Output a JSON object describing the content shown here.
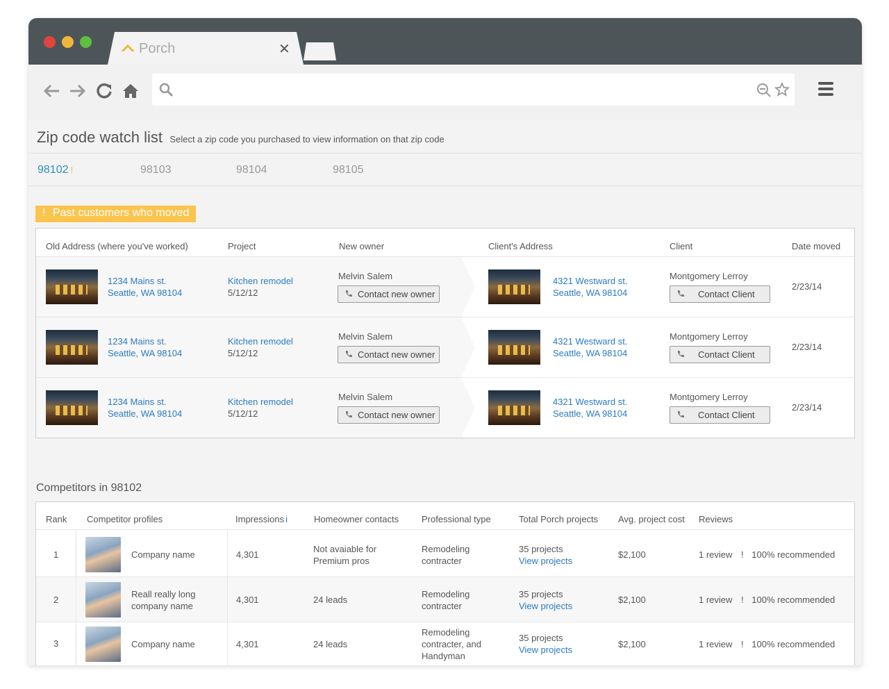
{
  "browser": {
    "tab_title": "Porch",
    "tab_close": "✕"
  },
  "page": {
    "title": "Zip code watch list",
    "subtitle": "Select a zip code you purchased to view information on that zip code",
    "zips": [
      {
        "label": "98102",
        "active": true,
        "marker": "!"
      },
      {
        "label": "98103"
      },
      {
        "label": "98104"
      },
      {
        "label": "98105"
      }
    ]
  },
  "past_customers": {
    "badge": "Past customers who moved",
    "badge_icon": "!",
    "headers": [
      "Old Address (where you've worked)",
      "Project",
      "New owner",
      "Client's Address",
      "Client",
      "Date moved"
    ],
    "rows": [
      {
        "old_addr1": "1234 Mains st.",
        "old_addr2": "Seattle, WA 98104",
        "project": "Kitchen remodel",
        "project_date": "5/12/12",
        "new_owner": "Melvin Salem",
        "contact_owner": "Contact new owner",
        "client_addr1": "4321 Westward st.",
        "client_addr2": "Seattle, WA 98104",
        "client": "Montgomery Lerroy",
        "contact_client": "Contact Client",
        "date_moved": "2/23/14"
      },
      {
        "old_addr1": "1234 Mains st.",
        "old_addr2": "Seattle, WA 98104",
        "project": "Kitchen remodel",
        "project_date": "5/12/12",
        "new_owner": "Melvin Salem",
        "contact_owner": "Contact new owner",
        "client_addr1": "4321 Westward st.",
        "client_addr2": "Seattle, WA 98104",
        "client": "Montgomery Lerroy",
        "contact_client": "Contact Client",
        "date_moved": "2/23/14"
      },
      {
        "old_addr1": "1234 Mains st.",
        "old_addr2": "Seattle, WA 98104",
        "project": "Kitchen remodel",
        "project_date": "5/12/12",
        "new_owner": "Melvin Salem",
        "contact_owner": "Contact new owner",
        "client_addr1": "4321 Westward st.",
        "client_addr2": "Seattle, WA 98104",
        "client": "Montgomery Lerroy",
        "contact_client": "Contact Client",
        "date_moved": "2/23/14"
      }
    ]
  },
  "competitors": {
    "title": "Competitors in 98102",
    "headers": [
      "Rank",
      "Competitor profiles",
      "Impressions",
      "Homeowner contacts",
      "Professional type",
      "Total Porch projects",
      "Avg. project cost",
      "Reviews"
    ],
    "info_marker": "i",
    "rows": [
      {
        "rank": "1",
        "name": "Company name",
        "impressions": "4,301",
        "contacts": "Not avaiable for Premium pros",
        "type": "Remodeling contracter",
        "projects": "35 projects",
        "view": "View projects",
        "cost": "$2,100",
        "reviews": "1 review",
        "recommended": "100% recommended",
        "rec_icon": "!"
      },
      {
        "rank": "2",
        "name": "Reall really long company name",
        "impressions": "4,301",
        "contacts": "24 leads",
        "type": "Remodeling contracter",
        "projects": "35 projects",
        "view": "View projects",
        "cost": "$2,100",
        "reviews": "1 review",
        "recommended": "100% recommended",
        "rec_icon": "!"
      },
      {
        "rank": "3",
        "name": "Company name",
        "impressions": "4,301",
        "contacts": "24 leads",
        "type": "Remodeling contracter, and Handyman",
        "projects": "35 projects",
        "view": "View projects",
        "cost": "$2,100",
        "reviews": "1 review",
        "recommended": "100% recommended",
        "rec_icon": "!"
      }
    ]
  },
  "colors": {
    "accent_blue": "#2a7bc0",
    "badge_yellow": "#fbc44d",
    "titlebar": "#4d5559"
  }
}
